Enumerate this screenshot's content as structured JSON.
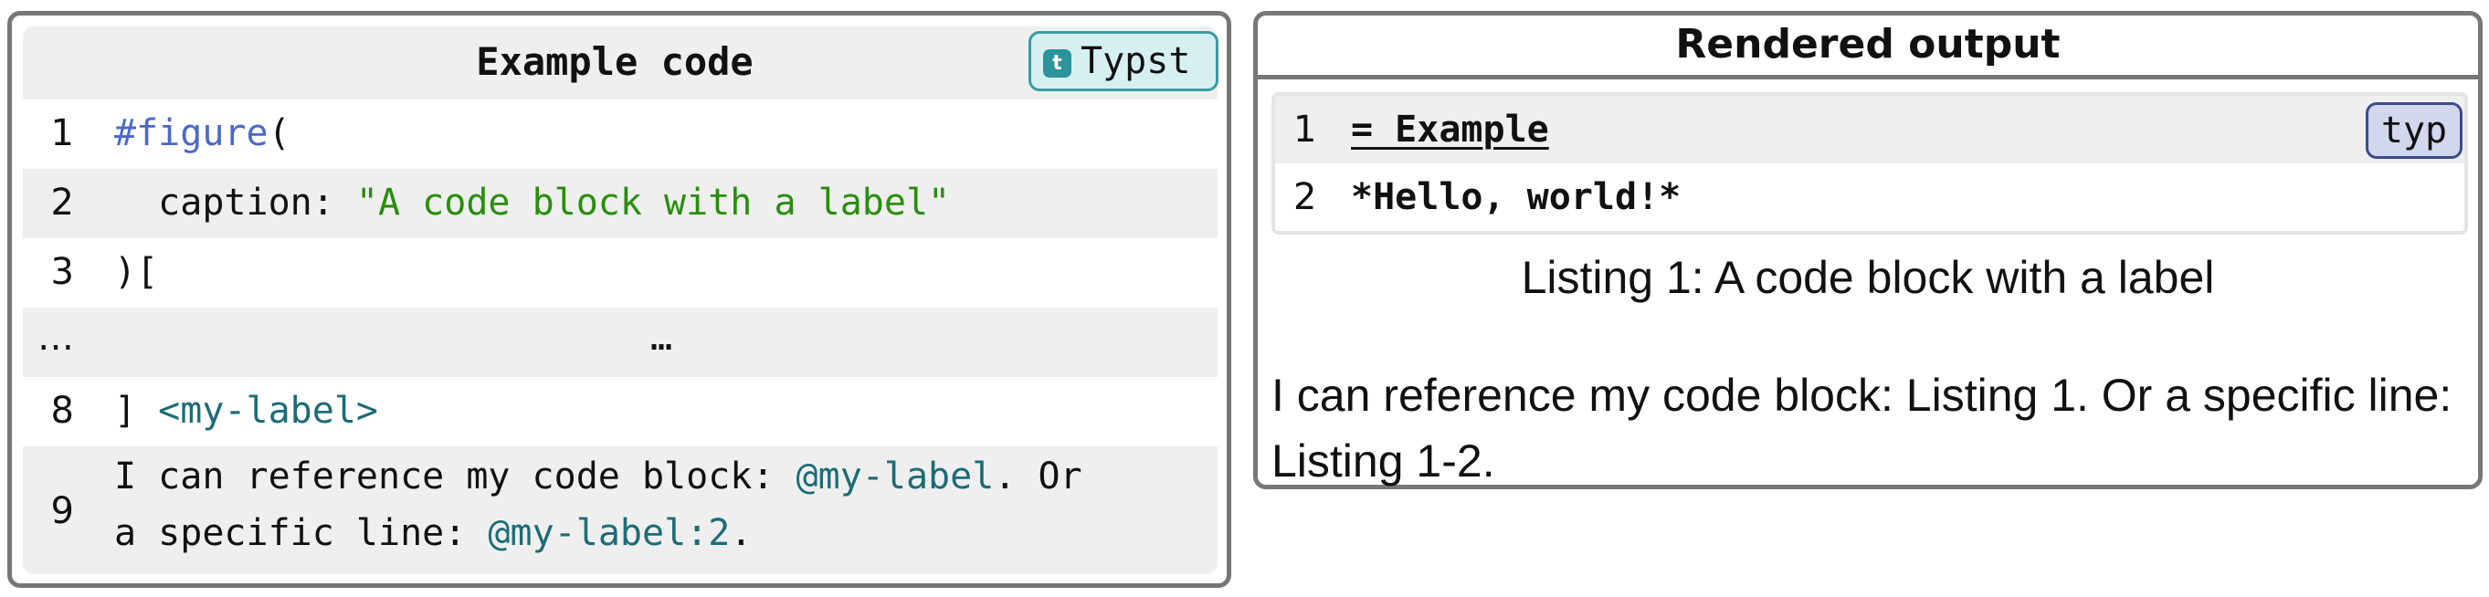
{
  "left_panel": {
    "title": "Example code",
    "badge": {
      "icon": "t",
      "label": "Typst",
      "icon_name": "typst-icon"
    },
    "lines": [
      {
        "num": "1",
        "parts": [
          {
            "text": "#figure",
            "kind": "keyword"
          },
          {
            "text": "(",
            "kind": "plain"
          }
        ]
      },
      {
        "num": "2",
        "parts": [
          {
            "text": "  caption: ",
            "kind": "plain"
          },
          {
            "text": "\"A code block with a label\"",
            "kind": "string"
          }
        ]
      },
      {
        "num": "3",
        "parts": [
          {
            "text": ")[",
            "kind": "plain"
          }
        ]
      },
      {
        "num": "…",
        "ellipsis": "…"
      },
      {
        "num": "8",
        "parts": [
          {
            "text": "] ",
            "kind": "plain"
          },
          {
            "text": "<my-label>",
            "kind": "label"
          }
        ]
      },
      {
        "num": "9",
        "line_a": [
          {
            "text": "I can reference my code block: ",
            "kind": "plain"
          },
          {
            "text": "@my-label",
            "kind": "label"
          },
          {
            "text": ". Or",
            "kind": "plain"
          }
        ],
        "line_b": [
          {
            "text": "a specific line: ",
            "kind": "plain"
          },
          {
            "text": "@my-label:2",
            "kind": "label"
          },
          {
            "text": ".",
            "kind": "plain"
          }
        ]
      }
    ]
  },
  "right_panel": {
    "title": "Rendered output",
    "badge_label": "typ",
    "code_lines": [
      {
        "num": "1",
        "text": "= Example"
      },
      {
        "num": "2",
        "text": "*Hello, world!*"
      }
    ],
    "caption": "Listing 1: A code block with a label",
    "body_line1": "I can reference my code block: Listing 1. Or a specific line:",
    "body_line2": "Listing 1-2."
  },
  "colors": {
    "keyword": "#4b69c6",
    "string": "#298e0d",
    "label": "#1d6c76",
    "typst_badge": "#2c939d",
    "typ_badge": "#d3d7ee",
    "border": "#777777"
  }
}
